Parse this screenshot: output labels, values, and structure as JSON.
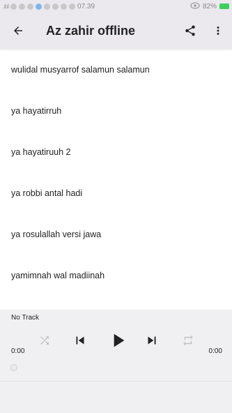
{
  "status_bar": {
    "time": "07.39",
    "battery": "82%"
  },
  "app_bar": {
    "title": "Az zahir offline"
  },
  "songs": [
    "wulidal musyarrof salamun salamun",
    "ya hayatirruh",
    "ya hayatiruuh 2",
    "ya robbi antal hadi",
    "ya rosulallah versi jawa",
    "yamimnah wal madiinah"
  ],
  "player": {
    "track": "No Track",
    "elapsed": "0:00",
    "duration": "0:00"
  },
  "colors": {
    "bar_bg": "#ebe9ee",
    "player_bg": "#f0eff2",
    "icon_dark": "#222222",
    "icon_disabled": "#c4c4c4"
  }
}
